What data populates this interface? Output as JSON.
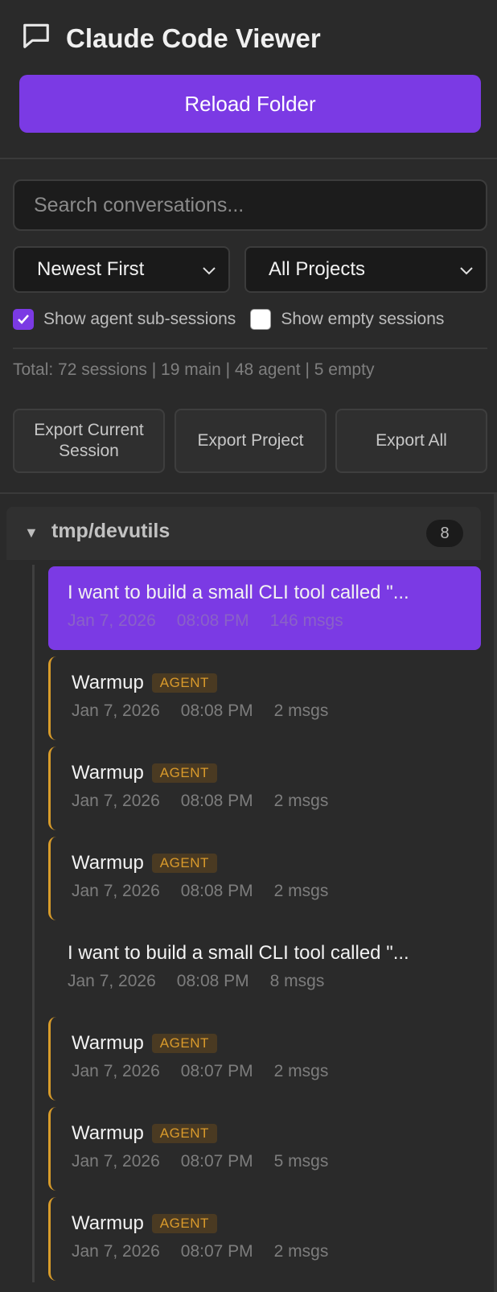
{
  "app": {
    "title": "Claude Code Viewer",
    "reload_label": "Reload Folder"
  },
  "search": {
    "placeholder": "Search conversations...",
    "value": ""
  },
  "filters": {
    "sort_value": "Newest First",
    "project_value": "All Projects",
    "show_agent_label": "Show agent sub-sessions",
    "show_agent_checked": true,
    "show_empty_label": "Show empty sessions",
    "show_empty_checked": false
  },
  "stats": {
    "total_text": "Total: 72 sessions | 19 main | 48 agent | 5 empty"
  },
  "exports": {
    "current_label": "Export Current Session",
    "project_label": "Export Project",
    "all_label": "Export All"
  },
  "project": {
    "name": "tmp/devutils",
    "count": "8",
    "toggle": "▼"
  },
  "sessions": [
    {
      "title": "I want to build a small CLI tool called \"...",
      "date": "Jan 7, 2026",
      "time": "08:08 PM",
      "msgs": "146 msgs",
      "agent": false,
      "active": true
    },
    {
      "title": "Warmup",
      "badge": "AGENT",
      "date": "Jan 7, 2026",
      "time": "08:08 PM",
      "msgs": "2 msgs",
      "agent": true
    },
    {
      "title": "Warmup",
      "badge": "AGENT",
      "date": "Jan 7, 2026",
      "time": "08:08 PM",
      "msgs": "2 msgs",
      "agent": true
    },
    {
      "title": "Warmup",
      "badge": "AGENT",
      "date": "Jan 7, 2026",
      "time": "08:08 PM",
      "msgs": "2 msgs",
      "agent": true
    },
    {
      "title": "I want to build a small CLI tool called \"...",
      "date": "Jan 7, 2026",
      "time": "08:08 PM",
      "msgs": "8 msgs",
      "agent": false
    },
    {
      "title": "Warmup",
      "badge": "AGENT",
      "date": "Jan 7, 2026",
      "time": "08:07 PM",
      "msgs": "2 msgs",
      "agent": true
    },
    {
      "title": "Warmup",
      "badge": "AGENT",
      "date": "Jan 7, 2026",
      "time": "08:07 PM",
      "msgs": "5 msgs",
      "agent": true
    },
    {
      "title": "Warmup",
      "badge": "AGENT",
      "date": "Jan 7, 2026",
      "time": "08:07 PM",
      "msgs": "2 msgs",
      "agent": true
    }
  ],
  "colors": {
    "accent": "#7b3ae4",
    "agent": "#d79b2a",
    "background": "#2a2a2a"
  }
}
